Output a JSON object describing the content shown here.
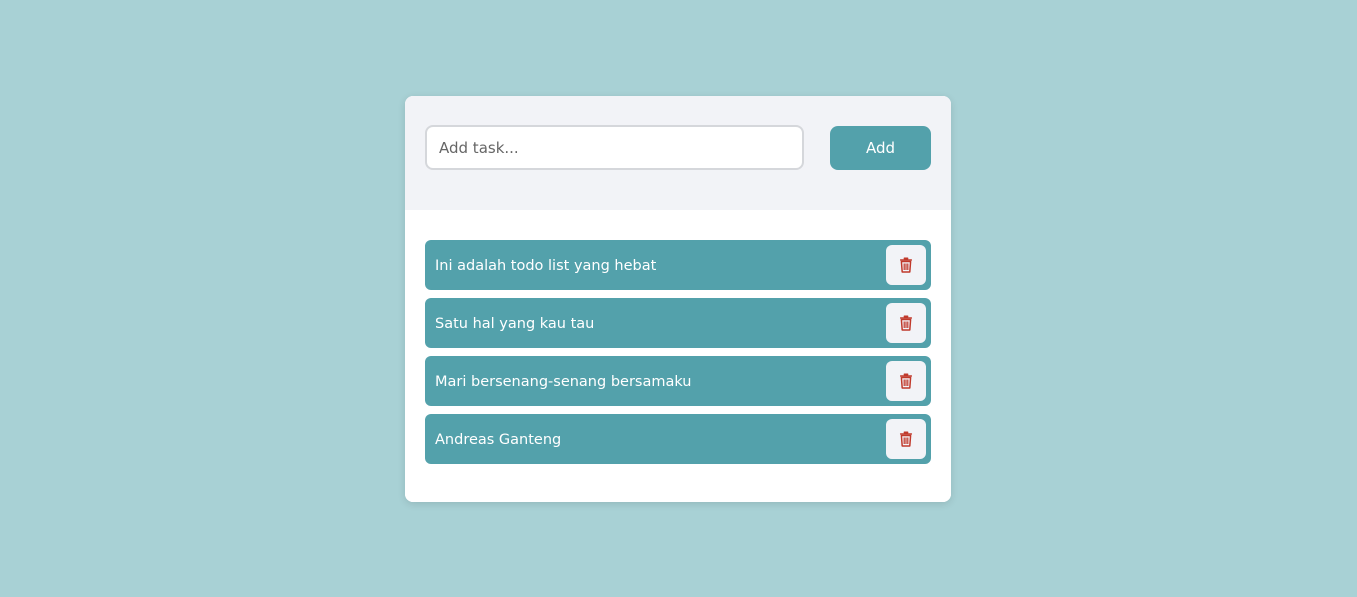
{
  "form": {
    "input_value": "",
    "input_placeholder": "Add task...",
    "add_label": "Add"
  },
  "todos": [
    {
      "text": "Ini adalah todo list yang hebat",
      "delete_icon": "trash-icon"
    },
    {
      "text": "Satu hal yang kau tau",
      "delete_icon": "trash-icon"
    },
    {
      "text": "Mari bersenang-senang bersamaku",
      "delete_icon": "trash-icon"
    },
    {
      "text": "Andreas Ganteng",
      "delete_icon": "trash-icon"
    }
  ],
  "colors": {
    "background": "#a8d1d5",
    "accent": "#53a1ab",
    "panel": "#f2f3f7",
    "danger_icon": "#c0392b"
  }
}
